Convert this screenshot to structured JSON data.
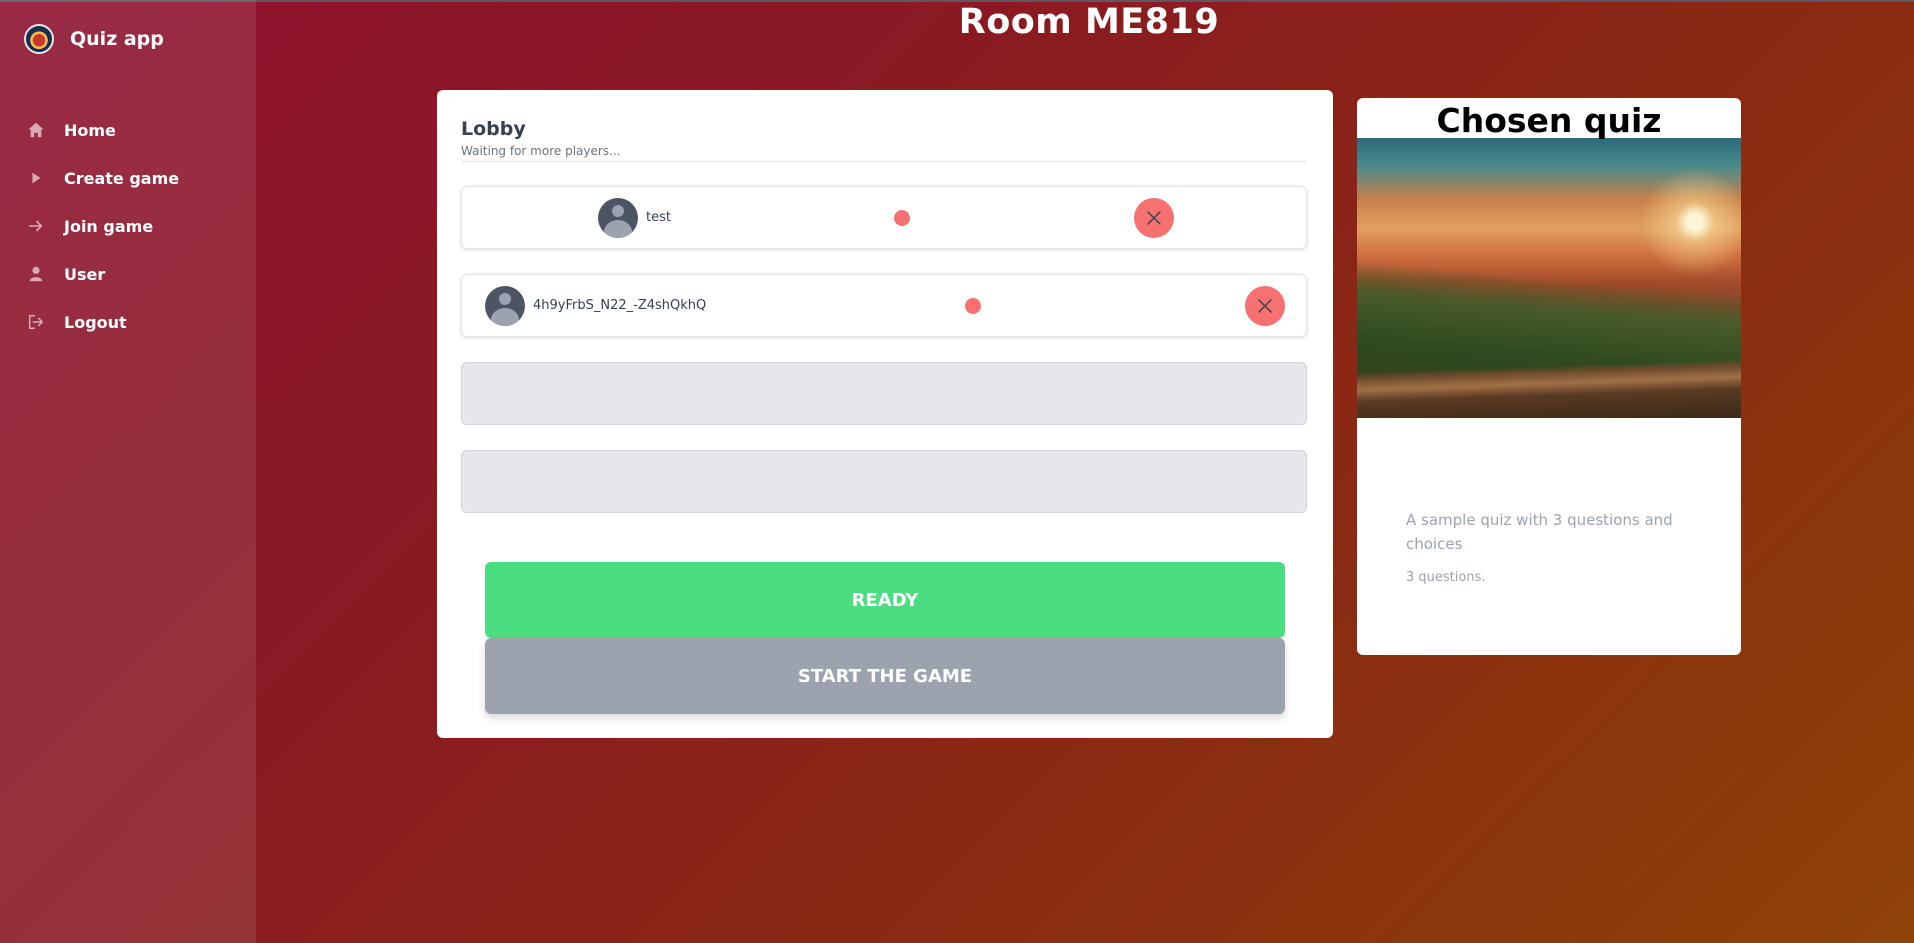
{
  "app": {
    "name": "Quiz app"
  },
  "sidebar": {
    "items": [
      {
        "label": "Home",
        "icon": "home-icon"
      },
      {
        "label": "Create game",
        "icon": "play-icon"
      },
      {
        "label": "Join game",
        "icon": "arrow-right-icon"
      },
      {
        "label": "User",
        "icon": "user-icon"
      },
      {
        "label": "Logout",
        "icon": "logout-icon"
      }
    ]
  },
  "room": {
    "title": "Room ME819"
  },
  "lobby": {
    "title": "Lobby",
    "subtitle": "Waiting for more players...",
    "players": [
      {
        "name": "test",
        "ready_status_color": "#f87171"
      },
      {
        "name": "4h9yFrbS_N22_-Z4shQkhQ",
        "ready_status_color": "#f87171"
      }
    ],
    "empty_slots": 2,
    "ready_label": "READY",
    "start_label": "START THE GAME"
  },
  "quiz": {
    "heading": "Chosen quiz",
    "description": "A sample quiz with 3 questions and choices",
    "question_count": "3 questions."
  },
  "colors": {
    "ready_button": "#4ade80",
    "start_button": "#9ca3af",
    "kick_button": "#f87171",
    "status_not_ready": "#f87171"
  }
}
